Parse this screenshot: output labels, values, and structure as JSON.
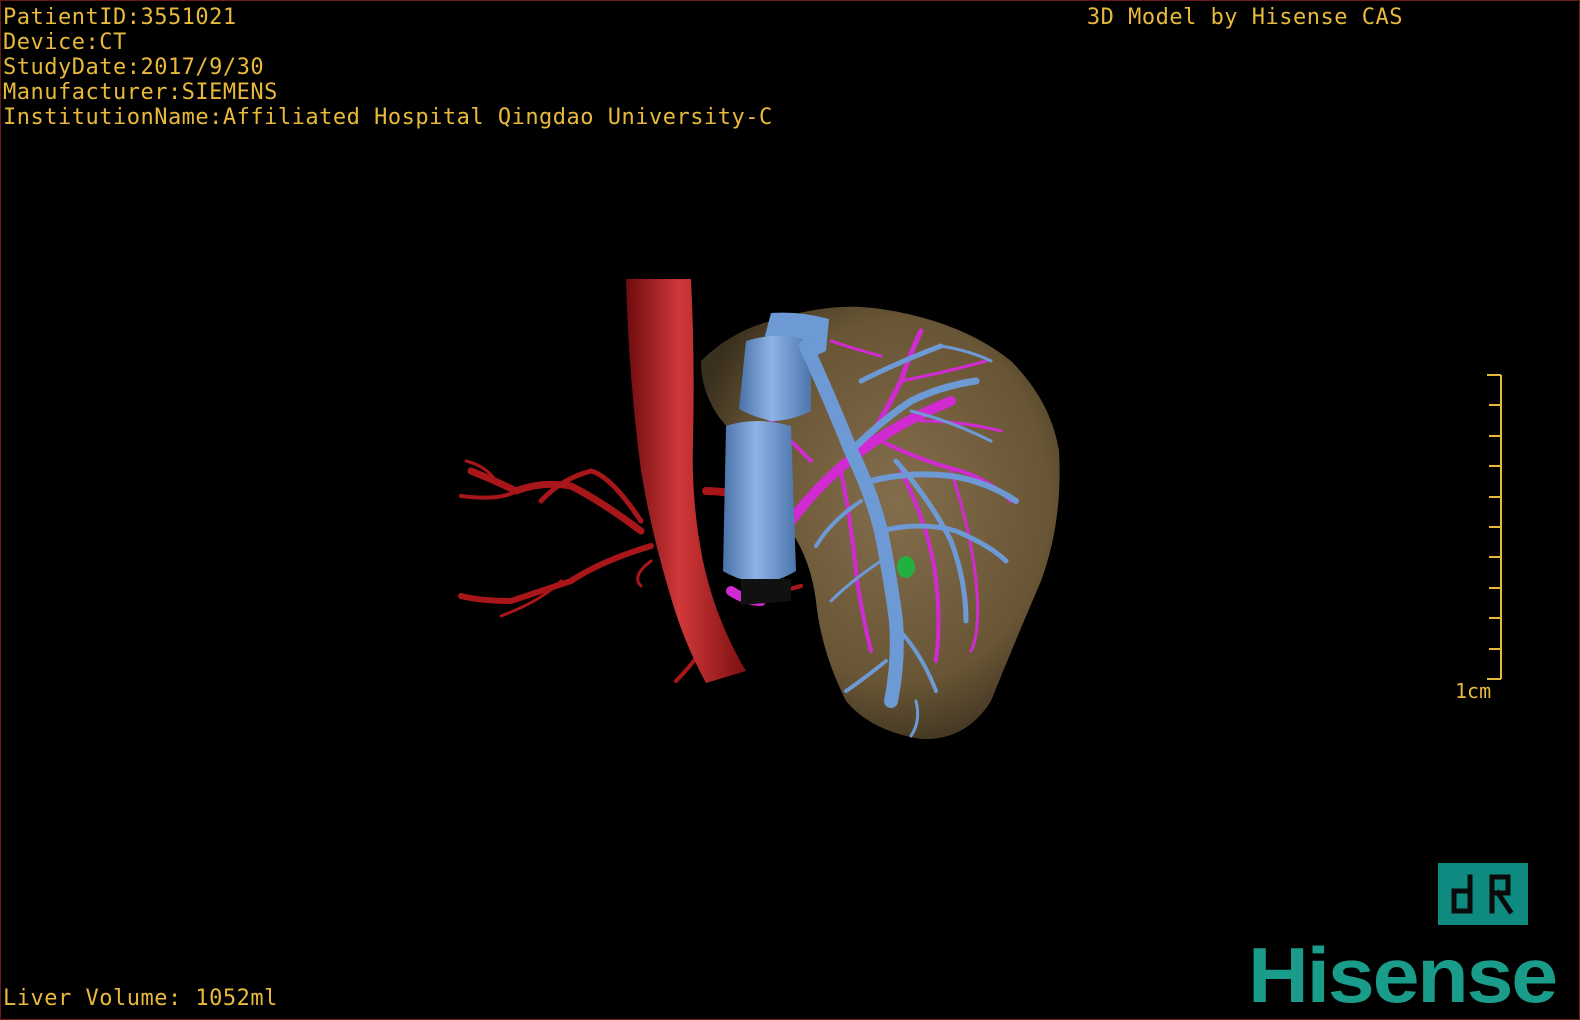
{
  "header": {
    "patient_id": "PatientID:3551021",
    "device": "Device:CT",
    "study_date": "StudyDate:2017/9/30",
    "manufacturer": "Manufacturer:SIEMENS",
    "institution": "InstitutionName:Affiliated Hospital Qingdao University-C",
    "credit": "3D Model by Hisense CAS"
  },
  "footer": {
    "liver_volume": "Liver Volume: 1052ml"
  },
  "scale_bar": {
    "label": "1cm",
    "ticks": 10
  },
  "logo": {
    "text": "Hisense",
    "badge_icon": "dr-logo-icon"
  },
  "colors": {
    "overlay_text": "#e8b93a",
    "liver": "#7a6440",
    "artery": "#b3181c",
    "portal_vein": "#6d9ad4",
    "hepatic_vein": "#d22ad2",
    "lesion": "#22b040",
    "brand": "#1a9c8a"
  }
}
